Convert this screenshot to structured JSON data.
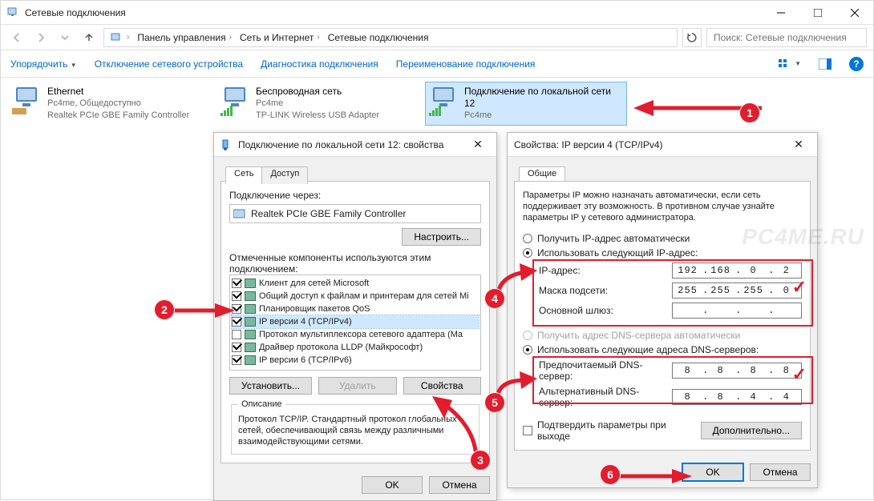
{
  "window": {
    "title": "Сетевые подключения",
    "breadcrumb": {
      "root_aria": "Панель управления (значок)",
      "items": [
        "Панель управления",
        "Сеть и Интернет",
        "Сетевые подключения"
      ]
    },
    "search_placeholder": "Поиск: Сетевые подключения",
    "commands": {
      "organize": "Упорядочить",
      "disable": "Отключение сетевого устройства",
      "diagnose": "Диагностика подключения",
      "rename": "Переименование подключения"
    }
  },
  "adapters": [
    {
      "name": "Ethernet",
      "line2": "Pc4me, Общедоступно",
      "line3": "Realtek PCIe GBE Family Controller",
      "icon": "ethernet",
      "selected": false
    },
    {
      "name": "Беспроводная сеть",
      "line2": "Pc4me",
      "line3": "TP-LINK Wireless USB Adapter",
      "icon": "wifi",
      "selected": false
    },
    {
      "name": "Подключение по локальной сети 12",
      "line2": "Pc4me",
      "line3": "",
      "icon": "wifi",
      "selected": true
    }
  ],
  "props_dialog": {
    "title": "Подключение по локальной сети 12: свойства",
    "tab_network": "Сеть",
    "tab_access": "Доступ",
    "connect_using_label": "Подключение через:",
    "connect_using_value": "Realtek PCIe GBE Family Controller",
    "configure_btn": "Настроить...",
    "components_label": "Отмеченные компоненты используются этим подключением:",
    "components": [
      {
        "checked": true,
        "label": "Клиент для сетей Microsoft"
      },
      {
        "checked": true,
        "label": "Общий доступ к файлам и принтерам для сетей Mi"
      },
      {
        "checked": true,
        "label": "Планировщик пакетов QoS"
      },
      {
        "checked": true,
        "label": "IP версии 4 (TCP/IPv4)",
        "selected": true
      },
      {
        "checked": false,
        "label": "Протокол мультиплексора сетевого адаптера (Ma"
      },
      {
        "checked": true,
        "label": "Драйвер протокола LLDP (Майкрософт)"
      },
      {
        "checked": true,
        "label": "IP версии 6 (TCP/IPv6)"
      }
    ],
    "install_btn": "Установить...",
    "remove_btn": "Удалить",
    "properties_btn": "Свойства",
    "desc_label": "Описание",
    "desc_text": "Протокол TCP/IP. Стандартный протокол глобальных сетей, обеспечивающий связь между различными взаимодействующими сетями.",
    "ok": "OK",
    "cancel": "Отмена"
  },
  "ipv4_dialog": {
    "title": "Свойства: IP версии 4 (TCP/IPv4)",
    "tab_general": "Общие",
    "info": "Параметры IP можно назначать автоматически, если сеть поддерживает эту возможность. В противном случае узнайте параметры IP у сетевого администратора.",
    "r_dhcp": "Получить IP-адрес автоматически",
    "r_static": "Использовать следующий IP-адрес:",
    "lbl_ip": "IP-адрес:",
    "lbl_mask": "Маска подсети:",
    "lbl_gw": "Основной шлюз:",
    "val_ip": [
      "192",
      "168",
      "0",
      "2"
    ],
    "val_mask": [
      "255",
      "255",
      "255",
      "0"
    ],
    "val_gw": [
      "",
      "",
      "",
      ""
    ],
    "r_dns_auto": "Получить адрес DNS-сервера автоматически",
    "r_dns_static": "Использовать следующие адреса DNS-серверов:",
    "lbl_dns1": "Предпочитаемый DNS-сервер:",
    "lbl_dns2": "Альтернативный DNS-сервер:",
    "val_dns1": [
      "8",
      "8",
      "8",
      "8"
    ],
    "val_dns2": [
      "8",
      "8",
      "4",
      "4"
    ],
    "validate_label": "Подтвердить параметры при выходе",
    "advanced": "Дополнительно...",
    "ok": "OK",
    "cancel": "Отмена"
  },
  "watermark": "PC4ME.RU",
  "markers": {
    "m1": "1",
    "m2": "2",
    "m3": "3",
    "m4": "4",
    "m5": "5",
    "m6": "6"
  }
}
